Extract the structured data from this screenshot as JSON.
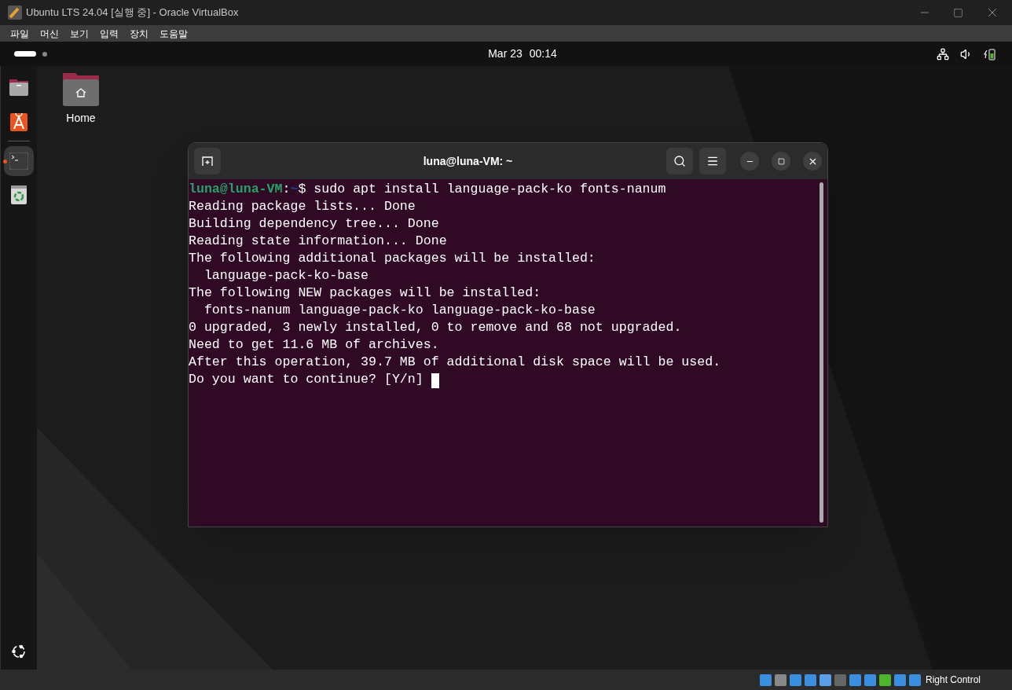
{
  "window": {
    "title": "Ubuntu LTS 24.04 [실행 중] - Oracle VirtualBox"
  },
  "menu": [
    "파일",
    "머신",
    "보기",
    "입력",
    "장치",
    "도움말"
  ],
  "top_bar": {
    "date": "Mar 23",
    "time": "00:14"
  },
  "dock": [
    {
      "kind": "files",
      "running": false
    },
    {
      "kind": "app-center",
      "running": false
    },
    {
      "kind": "terminal",
      "running": true
    },
    {
      "kind": "trash",
      "running": false
    }
  ],
  "desktop_icons": [
    {
      "label": "Home"
    }
  ],
  "terminal": {
    "title": "luna@luna-VM: ~",
    "lines": [
      {
        "kind": "prompt",
        "user": "luna@luna-VM",
        "separator": ":",
        "path": "~",
        "command": "$ sudo apt install language-pack-ko fonts-nanum"
      },
      {
        "kind": "output",
        "text": "Reading package lists... Done"
      },
      {
        "kind": "output",
        "text": "Building dependency tree... Done"
      },
      {
        "kind": "output",
        "text": "Reading state information... Done"
      },
      {
        "kind": "output",
        "text": "The following additional packages will be installed:"
      },
      {
        "kind": "output",
        "text": "  language-pack-ko-base"
      },
      {
        "kind": "output",
        "text": "The following NEW packages will be installed:"
      },
      {
        "kind": "output",
        "text": "  fonts-nanum language-pack-ko language-pack-ko-base"
      },
      {
        "kind": "output",
        "text": "0 upgraded, 3 newly installed, 0 to remove and 68 not upgraded."
      },
      {
        "kind": "output",
        "text": "Need to get 11.6 MB of archives."
      },
      {
        "kind": "output",
        "text": "After this operation, 39.7 MB of additional disk space will be used."
      },
      {
        "kind": "output",
        "text": "Do you want to continue? [Y/n] ",
        "cursor": true
      }
    ]
  },
  "status_bar": {
    "host_key": "Right Control"
  }
}
